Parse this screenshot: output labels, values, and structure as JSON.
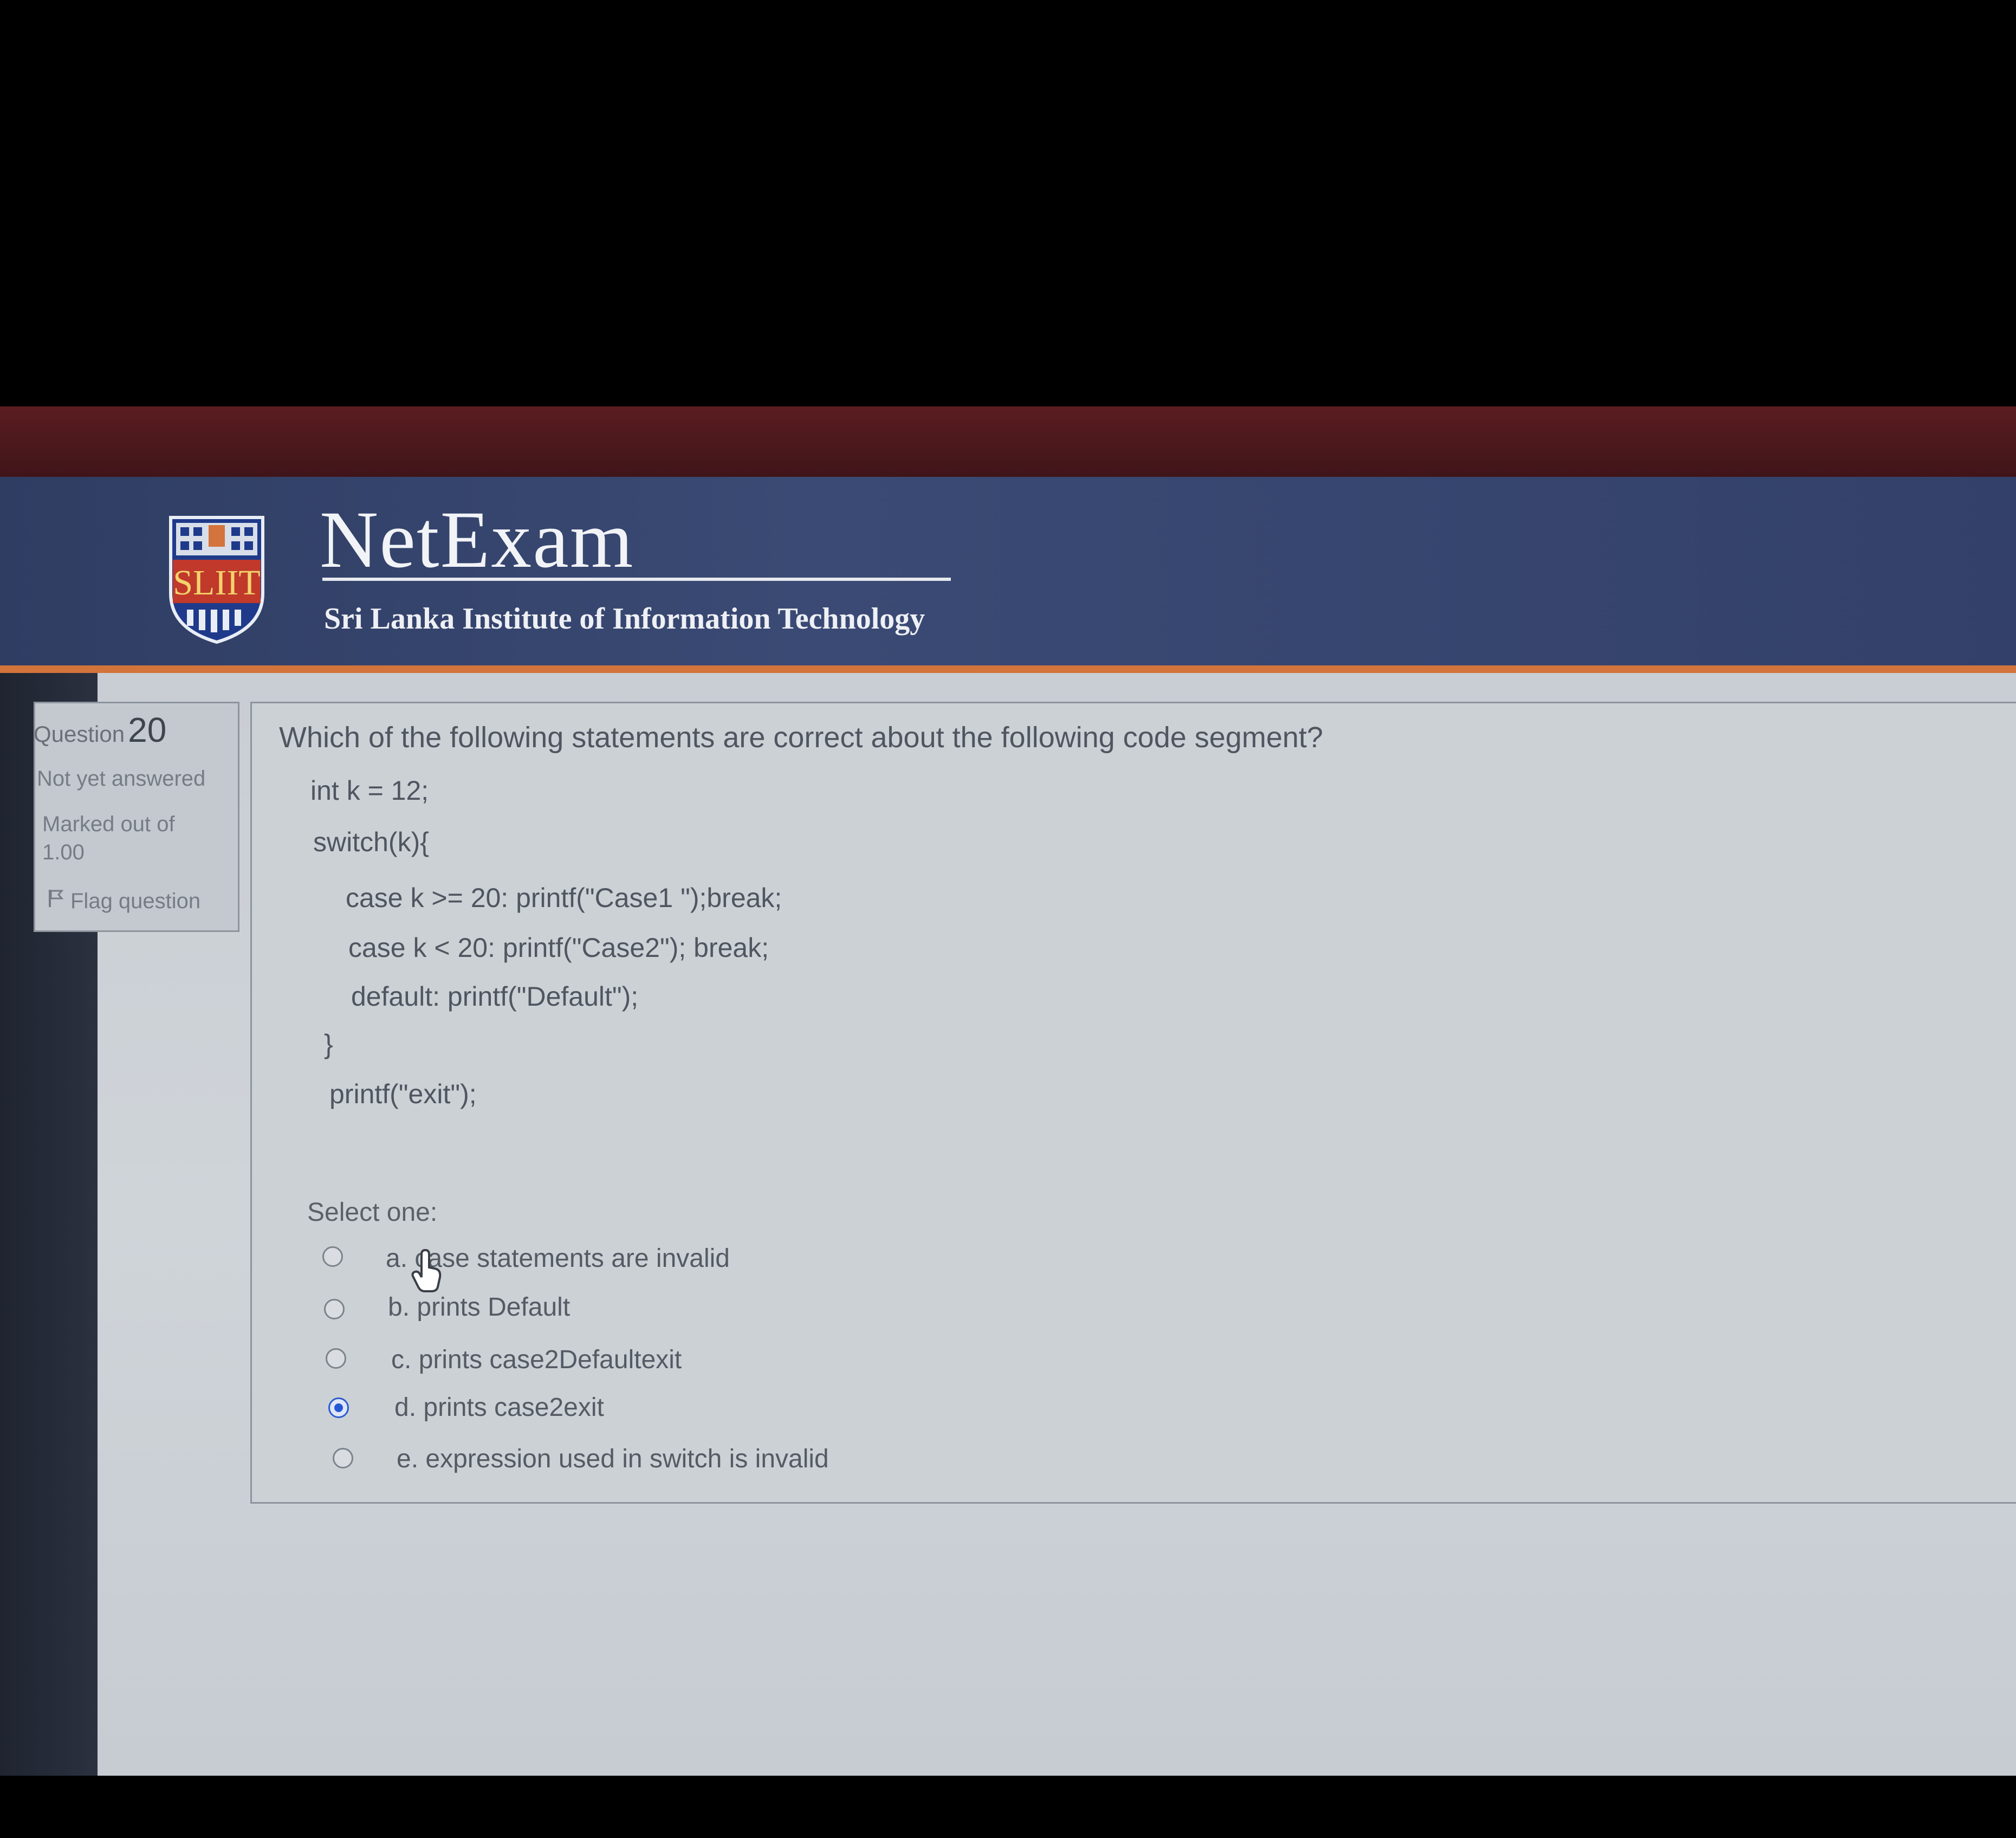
{
  "brand": {
    "logo_text": "SLIIT",
    "title": "NetExam",
    "subtitle": "Sri Lanka Institute of Information Technology"
  },
  "question_info": {
    "question_label": "Question",
    "question_number": "20",
    "status": "Not yet answered",
    "marked_label": "Marked out of",
    "marked_value": "1.00",
    "flag_label": "Flag question"
  },
  "question": {
    "text": "Which of the following statements are correct about the  following code segment?",
    "code_lines": [
      "int k = 12;",
      "switch(k){",
      "case k >= 20: printf(\"Case1 \");break;",
      "case k < 20: printf(\"Case2\"); break;",
      "default: printf(\"Default\");",
      "}",
      "printf(\"exit\");"
    ],
    "select_label": "Select one:",
    "options": [
      {
        "letter": "a.",
        "text": "case statements are invalid",
        "selected": false
      },
      {
        "letter": "b.",
        "text": "prints Default",
        "selected": false
      },
      {
        "letter": "c.",
        "text": "prints case2Defaultexit",
        "selected": false
      },
      {
        "letter": "d.",
        "text": "prints case2exit",
        "selected": true
      },
      {
        "letter": "e.",
        "text": "expression used in switch is invalid",
        "selected": false
      }
    ]
  },
  "colors": {
    "header_blue": "#34426b",
    "accent_orange": "#d3743c",
    "radio_selected": "#2458d6"
  }
}
